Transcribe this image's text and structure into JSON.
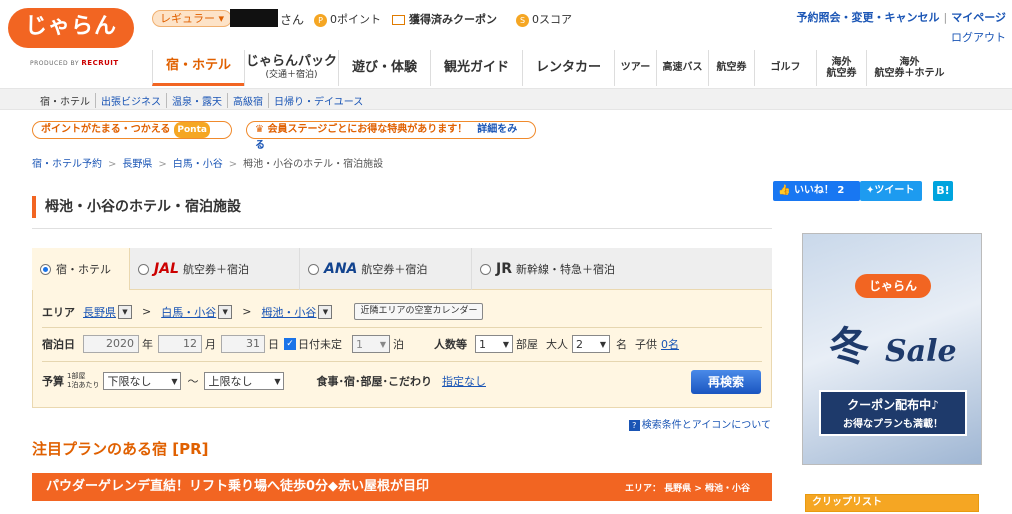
{
  "header": {
    "logo_text": "じゃらん",
    "logo_sub_prefix": "PRODUCED BY",
    "logo_sub_brand": "RECRUIT",
    "rank": "レギュラー",
    "honorific": "さん",
    "points_value": "0",
    "points_label": "ポイント",
    "coupons_label": "獲得済みクーポン",
    "score_value": "0",
    "score_label": "スコア",
    "top_links": [
      "予約照会・変更・キャンセル",
      "マイページ"
    ],
    "logout": "ログアウト"
  },
  "main_nav": [
    {
      "label": "宿・ホテル",
      "sub": ""
    },
    {
      "label": "じゃらんパック",
      "sub": "(交通＋宿泊)"
    },
    {
      "label": "遊び・体験",
      "sub": ""
    },
    {
      "label": "観光ガイド",
      "sub": ""
    },
    {
      "label": "レンタカー",
      "sub": ""
    },
    {
      "label": "ツアー",
      "sub": ""
    },
    {
      "label": "高速バス",
      "sub": ""
    },
    {
      "label": "航空券",
      "sub": ""
    },
    {
      "label": "ゴルフ",
      "sub": ""
    },
    {
      "label": "海外",
      "sub": "航空券"
    },
    {
      "label": "海外",
      "sub": "航空券＋ホテル"
    }
  ],
  "sub_nav": [
    "宿・ホテル",
    "出張ビジネス",
    "温泉・露天",
    "高級宿",
    "日帰り・デイユース"
  ],
  "banners": {
    "ponta_text": "ポイントがたまる・つかえる",
    "ponta_brand": "Ponta",
    "member_text": "会員ステージごとにお得な特典があります！",
    "member_link": "詳細をみる"
  },
  "breadcrumb": [
    "宿・ホテル予約",
    "長野県",
    "白馬・小谷",
    "栂池・小谷のホテル・宿泊施設"
  ],
  "page_title": "栂池・小谷のホテル・宿泊施設",
  "social": {
    "like": "いいね！",
    "like_count": "2",
    "tweet": "ツイート",
    "hatena": "B!"
  },
  "search": {
    "tabs": [
      {
        "brand": "",
        "label": "宿・ホテル",
        "selected": true
      },
      {
        "brand": "JAL",
        "label": "航空券＋宿泊",
        "selected": false
      },
      {
        "brand": "ANA",
        "label": "航空券＋宿泊",
        "selected": false
      },
      {
        "brand": "JR",
        "label": "新幹線・特急＋宿泊",
        "selected": false
      }
    ],
    "area_label": "エリア",
    "area": [
      "長野県",
      "白馬・小谷",
      "栂池・小谷"
    ],
    "area_sep": ">",
    "calendar_button": "近隣エリアの空室カレンダー",
    "stay_label": "宿泊日",
    "year": "2020",
    "year_unit": "年",
    "month": "12",
    "month_unit": "月",
    "day": "31",
    "day_unit": "日",
    "undecided": "日付未定",
    "nights": "1",
    "nights_unit": "泊",
    "people_label": "人数等",
    "rooms": "1",
    "rooms_unit": "部屋",
    "adults_label": "大人",
    "adults": "2",
    "adults_unit": "名",
    "children_label": "子供",
    "children": "0名",
    "budget_label": "予算",
    "budget_note1": "1部屋",
    "budget_note2": "1泊あたり",
    "budget_min": "下限なし",
    "budget_tilde": "〜",
    "budget_max": "上限なし",
    "conditions_label": "食事･宿･部屋･こだわり",
    "conditions_link": "指定なし",
    "search_button": "再検索",
    "help_link": "検索条件とアイコンについて"
  },
  "pr": {
    "title": "注目プランのある宿 [PR]",
    "plan_title": "パウダーゲレンデ直結！リフト乗り場へ徒歩0分◆赤い屋根が目印",
    "plan_area": "エリア： 長野県 > 栂池・小谷"
  },
  "ad": {
    "logo": "じゃらん",
    "winter": "冬",
    "sale": "Sale",
    "ribbon1": "クーポン配布中♪",
    "ribbon2": "お得なプランも満載！"
  },
  "clip_list": "クリップリスト",
  "colors": {
    "accent": "#f26522",
    "link": "#1a55b5",
    "search_bg": "#fff6e2"
  }
}
